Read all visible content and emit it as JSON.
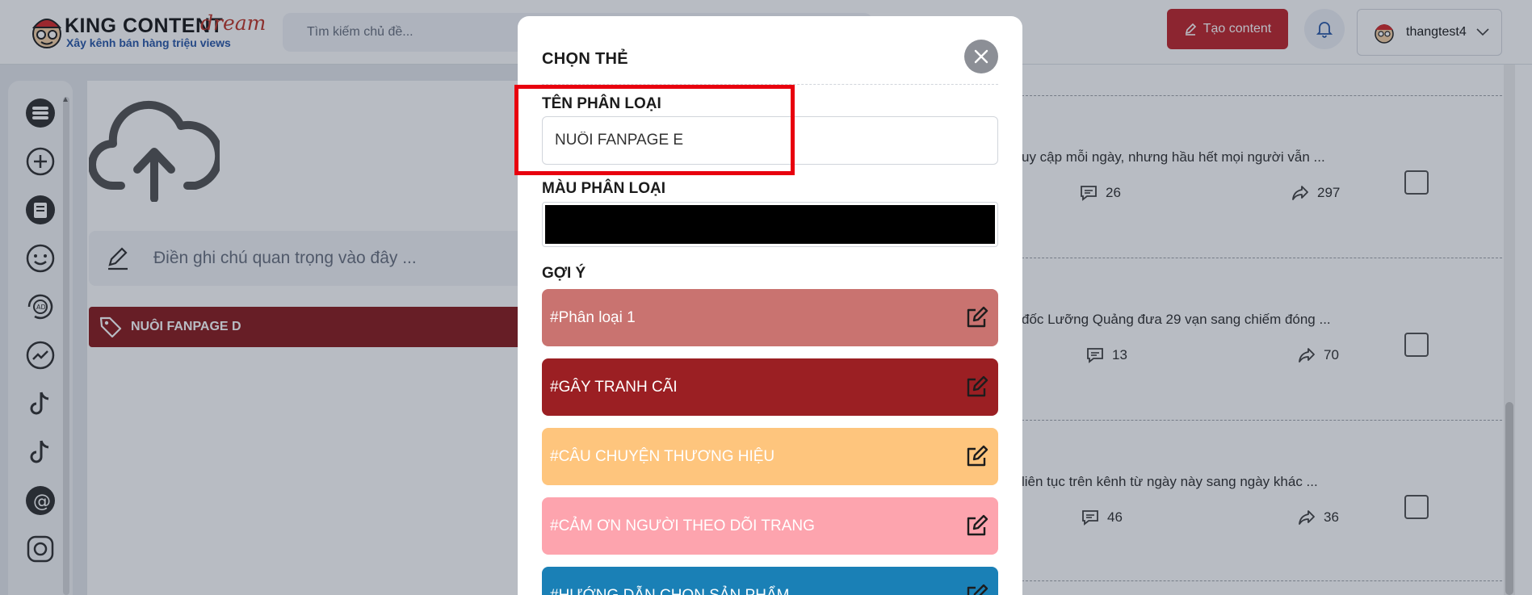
{
  "header": {
    "brand_name": "KING CONTENT",
    "brand_suffix": "dream",
    "slogan": "Xây kênh bán hàng triệu views",
    "search_placeholder": "Tìm kiếm chủ đề...",
    "create_label": "Tạo content",
    "username": "thangtest4"
  },
  "sidebar": {
    "icons": [
      "list-icon",
      "plus-circle-icon",
      "news-icon",
      "smile-icon",
      "ad-refresh-icon",
      "trend-icon",
      "tiktok-icon",
      "tiktok-icon",
      "threads-icon",
      "instagram-icon"
    ]
  },
  "left_panel": {
    "note_placeholder": "Điền ghi chú quan trọng vào đây ...",
    "tag_label": "NUÔI FANPAGE D",
    "tag_color": "#8b1d1f"
  },
  "posts": [
    {
      "excerpt": "uy cập mỗi ngày, nhưng hầu hết mọi người vẫn ...",
      "comments": "26",
      "shares": "297"
    },
    {
      "excerpt": "đốc Lưỡng Quảng đưa 29 vạn sang chiếm đóng ...",
      "comments": "13",
      "shares": "70"
    },
    {
      "excerpt": "liên tục trên kênh từ ngày này sang ngày khác ...",
      "comments": "46",
      "shares": "36"
    }
  ],
  "modal": {
    "title": "CHỌN THẺ",
    "name_label": "TÊN PHÂN LOẠI",
    "name_value": "NUÔI FANPAGE E",
    "color_label": "MÀU PHÂN LOẠI",
    "color_value": "#000000",
    "suggest_label": "GỢI Ý",
    "suggestions": [
      {
        "label": "#Phân loại 1",
        "color": "#c97370"
      },
      {
        "label": "#GÂY TRANH CÃI",
        "color": "#9b1f23"
      },
      {
        "label": "#CÂU CHUYỆN THƯƠNG HIỆU",
        "color": "#fec57d"
      },
      {
        "label": "#CẢM ƠN NGƯỜI THEO DÕI TRANG",
        "color": "#fda4ae"
      },
      {
        "label": "#HƯỚNG DẪN CHỌN SẢN PHẨM",
        "color": "#1a80b6"
      }
    ]
  },
  "colors": {
    "accent": "#c1272d",
    "highlight_box": "#e8000e"
  }
}
